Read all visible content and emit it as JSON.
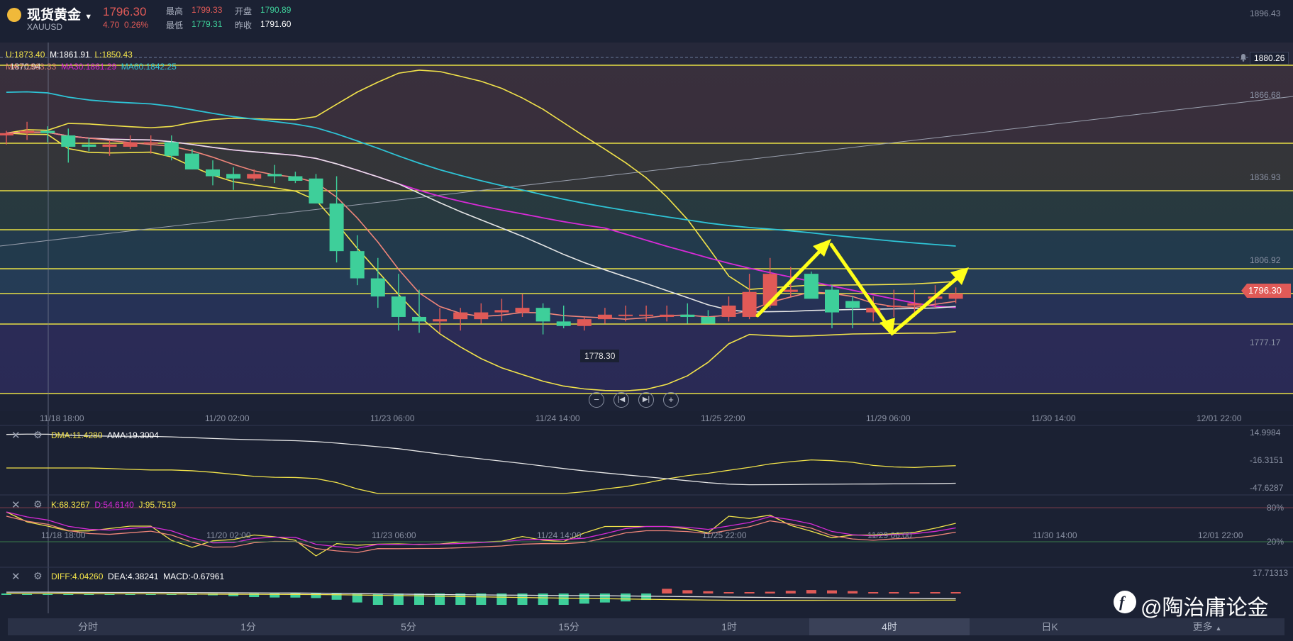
{
  "header": {
    "title": "现货黄金",
    "symbol": "XAUUSD",
    "price": "1796.30",
    "change": "4.70",
    "change_pct": "0.26%",
    "high_label": "最高",
    "high": "1799.33",
    "low_label": "最低",
    "low": "1779.31",
    "open_label": "开盘",
    "open": "1790.89",
    "prev_label": "昨收",
    "prev": "1791.60"
  },
  "indicators_main": {
    "boll_u": "U:1873.40",
    "boll_m": "M:1861.91",
    "boll_l": "L:1850.43",
    "ma_overlap": "1870.94",
    "ma_a": "MA?:1863.33",
    "ma30": "MA30:1861.29",
    "ma60": "MA60:1842.25"
  },
  "price_axis": [
    "1896.43",
    "1866.68",
    "1836.93",
    "1806.92",
    "1777.17"
  ],
  "price_markers": {
    "top_line": "1880.26",
    "current": "1796.30",
    "low_label": "1778.30"
  },
  "time_axis": [
    "11/18 18:00",
    "11/20 02:00",
    "11/23 06:00",
    "11/24 14:00",
    "11/25 22:00",
    "11/29 06:00",
    "11/30 14:00",
    "12/01 22:00"
  ],
  "sub1": {
    "dma": "DMA:11.4280",
    "ama": "AMA:19.3004",
    "axis": [
      "14.9984",
      "-16.3151",
      "-47.6287"
    ]
  },
  "sub2": {
    "k": "K:68.3267",
    "d": "D:54.6140",
    "j": "J:95.7519",
    "axis": [
      "80%",
      "20%"
    ]
  },
  "sub3": {
    "diff": "DIFF:4.04260",
    "dea": "DEA:4.38241",
    "macd": "MACD:-0.67961",
    "axis": [
      "17.71313"
    ]
  },
  "periods": [
    "分时",
    "1分",
    "5分",
    "15分",
    "1时",
    "4时",
    "日K",
    "更多"
  ],
  "active_period": "4时",
  "watermark": "@陶治庸论金",
  "colors": {
    "up": "#e05a57",
    "down": "#3ecf9a",
    "boll": "#f2e34a",
    "ma30": "#d82ad8",
    "ma60": "#2ec4d6",
    "ma_white": "#e6e6e6",
    "ma5": "#f0857a"
  },
  "chart_data": {
    "type": "candlestick",
    "x": [
      "11/18 18:00",
      "11/18 22:00",
      "11/19 02:00",
      "11/19 06:00",
      "11/19 10:00",
      "11/19 14:00",
      "11/19 18:00",
      "11/19 22:00",
      "11/20 02:00",
      "11/20 06:00",
      "11/20 10:00",
      "11/20 14:00",
      "11/20 18:00",
      "11/20 22:00",
      "11/21 02:00",
      "11/21 06:00",
      "11/21 10:00",
      "11/23 02:00",
      "11/23 06:00",
      "11/23 10:00",
      "11/23 14:00",
      "11/23 18:00",
      "11/23 22:00",
      "11/24 02:00",
      "11/24 06:00",
      "11/24 10:00",
      "11/24 14:00",
      "11/24 18:00",
      "11/24 22:00",
      "11/25 02:00",
      "11/25 06:00",
      "11/25 10:00",
      "11/25 14:00",
      "11/25 18:00",
      "11/25 22:00",
      "11/26 02:00",
      "11/26 06:00",
      "11/26 10:00",
      "11/26 14:00",
      "11/26 18:00",
      "11/26 22:00",
      "11/29 02:00",
      "11/29 06:00",
      "11/29 10:00",
      "11/29 14:00",
      "11/29 18:00",
      "11/29 22:00"
    ],
    "open": [
      1866,
      1867,
      1868,
      1866,
      1862,
      1861,
      1861,
      1863,
      1863,
      1858,
      1851,
      1849,
      1847,
      1849,
      1848,
      1847,
      1836,
      1815,
      1803,
      1795,
      1786,
      1784,
      1785,
      1785,
      1788,
      1788,
      1790,
      1784,
      1782,
      1785,
      1787,
      1787,
      1786,
      1787,
      1786,
      1786,
      1786,
      1791,
      1797,
      1805,
      1798,
      1793,
      1788,
      1791,
      1791,
      1794,
      1794
    ],
    "high": [
      1868,
      1872,
      1870,
      1869,
      1865,
      1864,
      1866,
      1866,
      1866,
      1860,
      1855,
      1852,
      1851,
      1853,
      1850,
      1849,
      1848,
      1822,
      1812,
      1805,
      1798,
      1790,
      1790,
      1792,
      1794,
      1796,
      1792,
      1791,
      1786,
      1790,
      1791,
      1791,
      1791,
      1792,
      1789,
      1795,
      1805,
      1812,
      1808,
      1806,
      1800,
      1795,
      1795,
      1798,
      1798,
      1800,
      1799
    ],
    "low": [
      1862,
      1864,
      1863,
      1854,
      1859,
      1857,
      1860,
      1858,
      1855,
      1851,
      1844,
      1842,
      1846,
      1845,
      1845,
      1841,
      1810,
      1800,
      1790,
      1780,
      1779,
      1779,
      1780,
      1783,
      1784,
      1786,
      1778.3,
      1781,
      1780,
      1783,
      1784,
      1784,
      1784,
      1783,
      1783,
      1784,
      1785,
      1790,
      1795,
      1795,
      1781,
      1781,
      1784,
      1786,
      1786,
      1790,
      1792
    ],
    "close": [
      1867,
      1868,
      1867,
      1861,
      1861,
      1862,
      1863,
      1863,
      1857,
      1851,
      1848,
      1847,
      1849,
      1848,
      1846,
      1836,
      1815,
      1803,
      1795,
      1786,
      1784,
      1785,
      1788,
      1788,
      1789,
      1790,
      1784,
      1782,
      1785,
      1787,
      1787,
      1787,
      1787,
      1786,
      1783,
      1791,
      1797,
      1805,
      1798,
      1794,
      1788,
      1790,
      1790,
      1791,
      1792,
      1795,
      1796.3
    ]
  }
}
